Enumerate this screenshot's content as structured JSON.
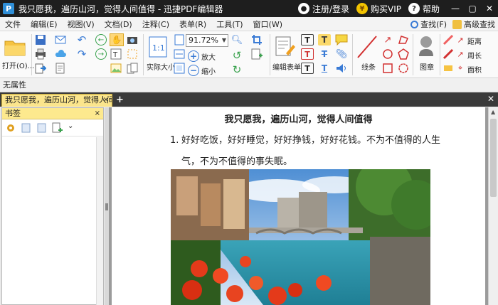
{
  "titlebar": {
    "app_logo": "P",
    "title": "我只愿我，遍历山河，觉得人间值得 - 迅捷PDF编辑器",
    "login_label": "注册/登录",
    "vip_label": "购买VIP",
    "help_label": "帮助",
    "minimize": "—",
    "maximize": "▢",
    "close": "✕"
  },
  "menubar": {
    "items": [
      "文件",
      "编辑(E)",
      "视图(V)",
      "文档(D)",
      "注释(C)",
      "表单(R)",
      "工具(T)",
      "窗口(W)"
    ],
    "search_label": "查找(F)",
    "advanced_search_label": "高级查找"
  },
  "ribbon": {
    "open_label": "打开(O)...",
    "zoom_value": "91.72%",
    "actual_size_label": "实际大小",
    "zoom_in_label": "放大",
    "zoom_out_label": "缩小",
    "edit_form_label": "编辑表单",
    "lines_label": "线条",
    "stamp_label": "图章",
    "distance_label": "距离",
    "perimeter_label": "周长",
    "area_label": "面积"
  },
  "status": {
    "properties_text": "无属性"
  },
  "tabs": {
    "doc_tab_label": "我只愿我，遍历山河，觉得人间值得",
    "tab_close": "×",
    "add_tab": "+",
    "close_all": "✕"
  },
  "bookmark_panel": {
    "title": "书签",
    "close": "×"
  },
  "document": {
    "title": "我只愿我，遍历山河，觉得人间值得",
    "list_number": "1.",
    "line1": "好好吃饭，好好睡觉，好好挣钱，好好花钱。不为不值得的人生",
    "line2": "气，不为不值得的事失眠。"
  },
  "colors": {
    "titlebar_bg": "#1e1e1e",
    "tab_active": "#fbe58c",
    "vip_gold": "#f2c300"
  }
}
